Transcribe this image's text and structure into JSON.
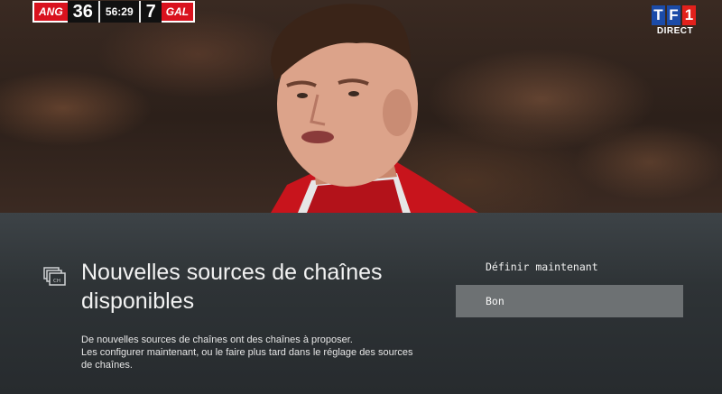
{
  "broadcast": {
    "home_team": "ANG",
    "home_score": "36",
    "clock": "56:29",
    "away_score": "7",
    "away_team": "GAL",
    "channel_logo": [
      "T",
      "F",
      "1"
    ],
    "live_label": "DIRECT"
  },
  "dialog": {
    "icon": "channel-sources-icon",
    "title": "Nouvelles sources de chaînes disponibles",
    "description": "De nouvelles sources de chaînes ont des chaînes à proposer.\n Les configurer maintenant, ou le faire plus tard dans le réglage des sources de chaînes.",
    "actions": {
      "define_now": "Définir maintenant",
      "ok": "Bon"
    }
  },
  "colors": {
    "team_red": "#d9121e",
    "tf1_blue": "#1b4ba8",
    "tf1_red": "#e2211c",
    "button_bg": "#6d7173"
  }
}
